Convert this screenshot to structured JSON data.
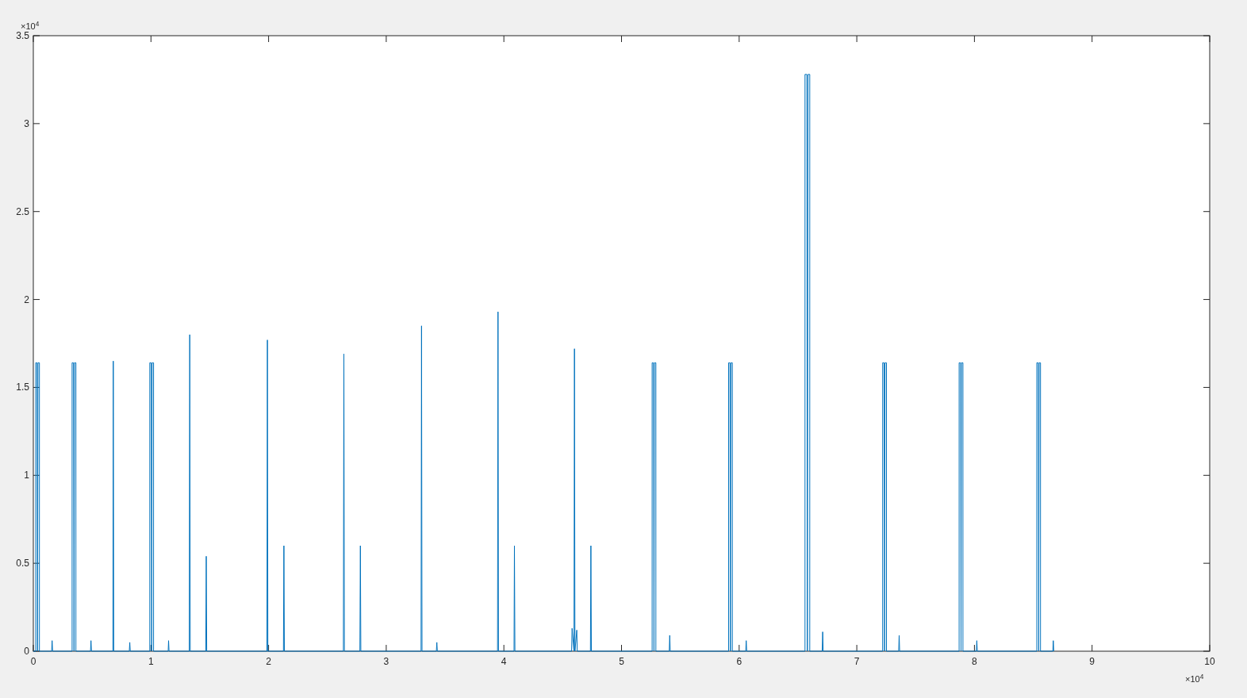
{
  "figure": {
    "x_exponent": "×10$^{4}$",
    "y_exponent": "×10$^{4}$",
    "chart_data": {
      "type": "line",
      "xlim": [
        0,
        10
      ],
      "ylim": [
        0,
        3.5
      ],
      "xticks": [
        0,
        1,
        2,
        3,
        4,
        5,
        6,
        7,
        8,
        9,
        10
      ],
      "yticks": [
        0,
        0.5,
        1,
        1.5,
        2,
        2.5,
        3,
        3.5
      ],
      "x": [
        0,
        0.02,
        0.02,
        0.032,
        0.036,
        0.04,
        0.052,
        0.052,
        0.156,
        0.16,
        0.164,
        0.33,
        0.33,
        0.342,
        0.346,
        0.35,
        0.362,
        0.362,
        0.486,
        0.49,
        0.494,
        0.676,
        0.68,
        0.684,
        0.816,
        0.82,
        0.824,
        0.99,
        0.99,
        1.002,
        1.006,
        1.01,
        1.022,
        1.022,
        1.146,
        1.15,
        1.154,
        1.326,
        1.33,
        1.334,
        1.466,
        1.47,
        1.474,
        1.986,
        1.99,
        1.994,
        2.126,
        2.13,
        2.134,
        2.636,
        2.64,
        2.644,
        2.776,
        2.78,
        2.784,
        3.296,
        3.3,
        3.304,
        3.426,
        3.43,
        3.434,
        3.946,
        3.95,
        3.954,
        4.086,
        4.09,
        4.094,
        4.576,
        4.58,
        4.596,
        4.6,
        4.604,
        4.62,
        4.624,
        4.736,
        4.74,
        4.744,
        5.26,
        5.26,
        5.272,
        5.276,
        5.28,
        5.292,
        5.292,
        5.406,
        5.41,
        5.414,
        5.91,
        5.91,
        5.922,
        5.926,
        5.93,
        5.942,
        5.942,
        6.056,
        6.06,
        6.064,
        6.56,
        6.56,
        6.575,
        6.58,
        6.585,
        6.6,
        6.6,
        6.706,
        6.71,
        6.714,
        7.22,
        7.22,
        7.232,
        7.236,
        7.24,
        7.252,
        7.252,
        7.356,
        7.36,
        7.364,
        7.87,
        7.87,
        7.882,
        7.886,
        7.89,
        7.902,
        7.902,
        8.016,
        8.02,
        8.024,
        8.53,
        8.53,
        8.542,
        8.546,
        8.55,
        8.562,
        8.562,
        8.666,
        8.67,
        8.674
      ],
      "series": [
        {
          "color": "#0072bd",
          "values": [
            0,
            0,
            1.64,
            1.64,
            0,
            1.64,
            1.64,
            0,
            0,
            0.06,
            0,
            0,
            1.64,
            1.64,
            0,
            1.64,
            1.64,
            0,
            0,
            0.06,
            0,
            0,
            1.65,
            0,
            0,
            0.05,
            0,
            0,
            1.64,
            1.64,
            0,
            1.64,
            1.64,
            0,
            0,
            0.06,
            0,
            0,
            1.8,
            0,
            0,
            0.54,
            0,
            0,
            1.77,
            0,
            0,
            0.6,
            0,
            0,
            1.69,
            0,
            0,
            0.6,
            0,
            0,
            1.85,
            0,
            0,
            0.05,
            0,
            0,
            1.93,
            0,
            0,
            0.6,
            0,
            0,
            0.13,
            0,
            1.72,
            0,
            0.12,
            0,
            0,
            0.6,
            0,
            0,
            1.64,
            1.64,
            0,
            1.64,
            1.64,
            0,
            0,
            0.09,
            0,
            0,
            1.64,
            1.64,
            0,
            1.64,
            1.64,
            0,
            0,
            0.06,
            0,
            0,
            3.28,
            3.28,
            0,
            3.28,
            3.28,
            0,
            0,
            0.11,
            0,
            0,
            1.64,
            1.64,
            0,
            1.64,
            1.64,
            0,
            0,
            0.09,
            0,
            0,
            1.64,
            1.64,
            0,
            1.64,
            1.64,
            0,
            0,
            0.06,
            0,
            0,
            1.64,
            1.64,
            0,
            1.64,
            1.64,
            0,
            0,
            0.06,
            0
          ]
        }
      ]
    }
  }
}
